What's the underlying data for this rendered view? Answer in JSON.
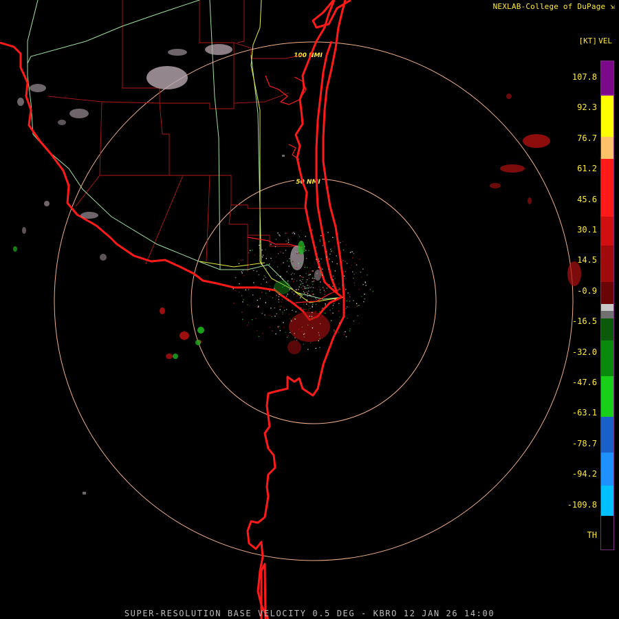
{
  "credit": "NEXLAB-College of DuPage",
  "credit_icon": "external-link-icon",
  "footer": "SUPER-RESOLUTION BASE VELOCITY 0.5 DEG - KBRO 12 JAN 26 14:00",
  "legend": {
    "product": "VEL",
    "unit": "[KT]",
    "values": [
      "107.8",
      "92.3",
      "76.7",
      "61.2",
      "45.6",
      "30.1",
      "14.5",
      "-0.9",
      "-16.5",
      "-32.0",
      "-47.6",
      "-63.1",
      "-78.7",
      "-94.2",
      "-109.8",
      "TH"
    ]
  },
  "colorbar_segments": [
    {
      "color": "#7a0a8a",
      "weight": 45
    },
    {
      "color": "#8f1aa0",
      "weight": 2
    },
    {
      "color": "#ffff00",
      "weight": 57
    },
    {
      "color": "#ffc06a",
      "weight": 30
    },
    {
      "color": "#ff1a1a",
      "weight": 80
    },
    {
      "color": "#d01010",
      "weight": 40
    },
    {
      "color": "#a00a0a",
      "weight": 50
    },
    {
      "color": "#6a0505",
      "weight": 30
    },
    {
      "color": "#c8c8c8",
      "weight": 10
    },
    {
      "color": "#707070",
      "weight": 10
    },
    {
      "color": "#0a5a0a",
      "weight": 30
    },
    {
      "color": "#0a8a0a",
      "weight": 50
    },
    {
      "color": "#19d019",
      "weight": 55
    },
    {
      "color": "#1a60c8",
      "weight": 50
    },
    {
      "color": "#1e90ff",
      "weight": 45
    },
    {
      "color": "#00c0ff",
      "weight": 42
    },
    {
      "color": "#000000",
      "weight": 46
    }
  ],
  "range_rings": [
    "50 NMI",
    "100 NMI"
  ],
  "colors": {
    "coast": "#ff1a1a",
    "county": "#b01818",
    "highway_green": "#9fe09f",
    "highway_yellow": "#e8f040",
    "ring": "#f0b08a",
    "text": "#ffea3c"
  }
}
